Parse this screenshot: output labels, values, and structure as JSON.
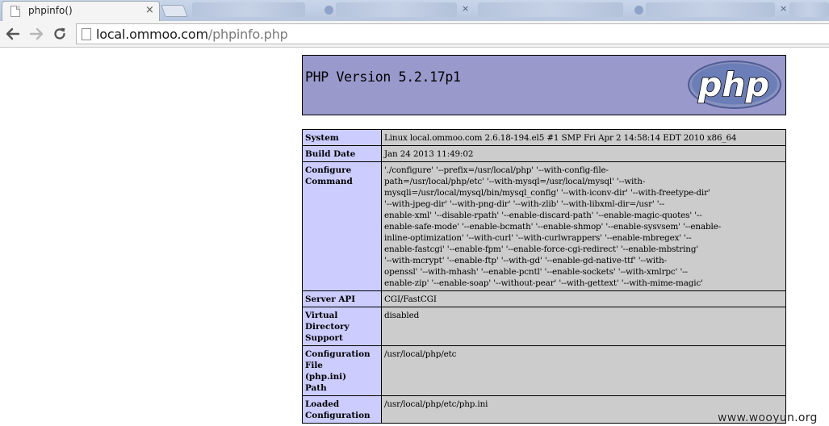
{
  "browser": {
    "tab_title": "phpinfo()",
    "tab_close_glyph": "×",
    "url_host": "local.ommoo.com",
    "url_path": "/phpinfo.php"
  },
  "php": {
    "version_title": "PHP Version 5.2.17p1",
    "logo_text": "php"
  },
  "rows": {
    "system": {
      "label": "System",
      "value": "Linux local.ommoo.com 2.6.18-194.el5 #1 SMP Fri Apr 2 14:58:14 EDT 2010 x86_64"
    },
    "build_date": {
      "label": "Build Date",
      "value": "Jan 24 2013 11:49:02"
    },
    "configure_command": {
      "label_line1": "Configure",
      "label_line2": "Command",
      "lines": [
        "'./configure' '--prefix=/usr/local/php' '--with-config-file-",
        "path=/usr/local/php/etc' '--with-mysql=/usr/local/mysql' '--with-",
        "mysqli=/usr/local/mysql/bin/mysql_config' '--with-iconv-dir' '--with-freetype-dir'",
        "'--with-jpeg-dir' '--with-png-dir' '--with-zlib' '--with-libxml-dir=/usr' '--",
        "enable-xml' '--disable-rpath' '--enable-discard-path' '--enable-magic-quotes' '--",
        "enable-safe-mode' '--enable-bcmath' '--enable-shmop' '--enable-sysvsem' '--enable-",
        "inline-optimization' '--with-curl' '--with-curlwrappers' '--enable-mbregex' '--",
        "enable-fastcgi' '--enable-fpm' '--enable-force-cgi-redirect' '--enable-mbstring'",
        "'--with-mcrypt' '--enable-ftp' '--with-gd' '--enable-gd-native-ttf' '--with-",
        "openssl' '--with-mhash' '--enable-pcntl' '--enable-sockets' '--with-xmlrpc' '--",
        "enable-zip' '--enable-soap' '--without-pear' '--with-gettext' '--with-mime-magic'"
      ]
    },
    "server_api": {
      "label": "Server API",
      "value": "CGI/FastCGI"
    },
    "virtual_directory": {
      "label_line1": "Virtual",
      "label_line2": "Directory",
      "label_line3": "Support",
      "value": "disabled"
    },
    "config_file_path": {
      "label_line1": "Configuration",
      "label_line2": "File",
      "label_line3": "(php.ini)",
      "label_line4": "Path",
      "value": "/usr/local/php/etc"
    },
    "loaded_config": {
      "label_line1": "Loaded",
      "label_line2": "Configuration",
      "value": "/usr/local/php/etc/php.ini"
    }
  },
  "watermark": "www.wooyun.org",
  "colors": {
    "header_bg": "#9999cc",
    "label_bg": "#ccccff",
    "value_bg": "#cccccc",
    "logo_fill": "#6c7eb7"
  }
}
